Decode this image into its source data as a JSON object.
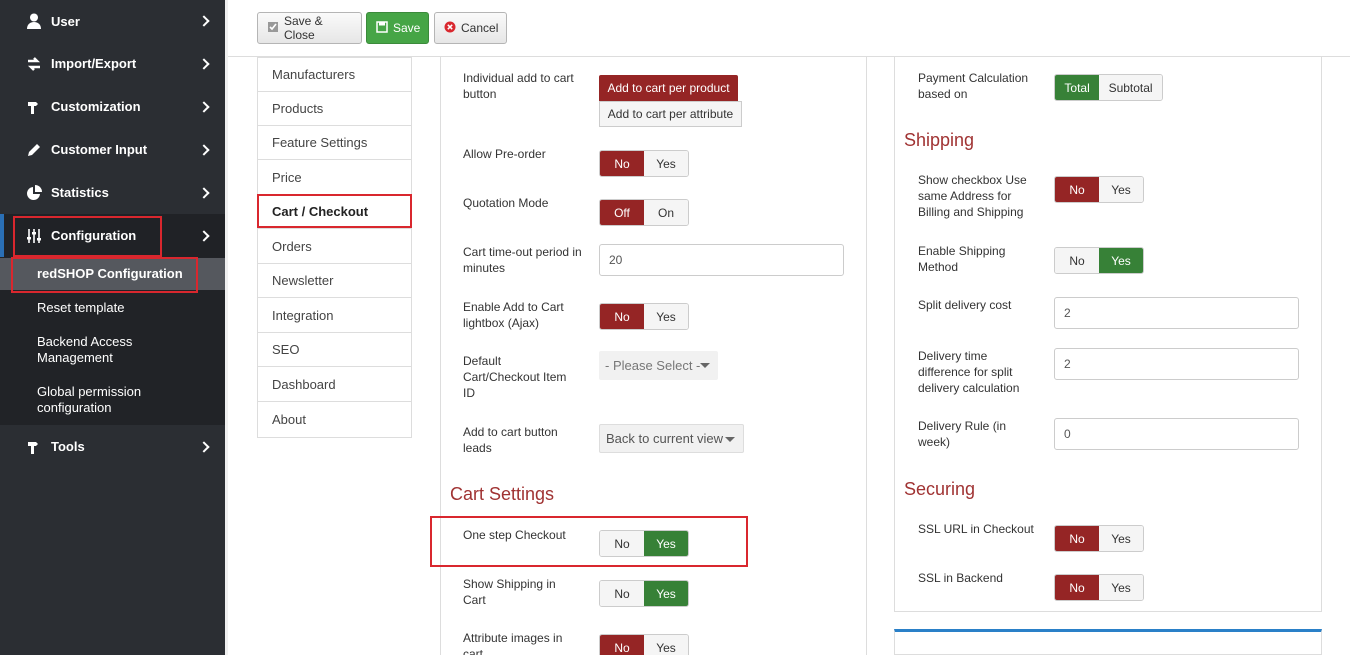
{
  "sidebar": {
    "items": [
      {
        "label": "User",
        "icon": "user-icon"
      },
      {
        "label": "Import/Export",
        "icon": "import-export-icon"
      },
      {
        "label": "Customization",
        "icon": "hammer-icon"
      },
      {
        "label": "Customer Input",
        "icon": "pencil-icon"
      },
      {
        "label": "Statistics",
        "icon": "pie-chart-icon"
      },
      {
        "label": "Configuration",
        "icon": "sliders-icon"
      },
      {
        "label": "Tools",
        "icon": "hammer-icon"
      }
    ],
    "sub_items": [
      "redSHOP Configuration",
      "Reset template",
      "Backend Access Management",
      "Global permission configuration"
    ]
  },
  "toolbar": {
    "save_close": "Save & Close",
    "save": "Save",
    "cancel": "Cancel"
  },
  "tabs": [
    "Manufacturers",
    "Products",
    "Feature Settings",
    "Price",
    "Cart / Checkout",
    "Orders",
    "Newsletter",
    "Integration",
    "SEO",
    "Dashboard",
    "About"
  ],
  "left": {
    "individual_add": {
      "label": "Individual add to cart button",
      "opt1": "Add to cart per product",
      "opt2": "Add to cart per attribute"
    },
    "preorder": {
      "label": "Allow Pre-order",
      "no": "No",
      "yes": "Yes"
    },
    "quotation": {
      "label": "Quotation Mode",
      "off": "Off",
      "on": "On"
    },
    "timeout": {
      "label": "Cart time-out period in minutes",
      "value": "20"
    },
    "lightbox": {
      "label": "Enable Add to Cart lightbox (Ajax)",
      "no": "No",
      "yes": "Yes"
    },
    "default_item": {
      "label": "Default Cart/Checkout Item ID",
      "value": "- Please Select -"
    },
    "button_leads": {
      "label": "Add to cart button leads",
      "value": "Back to current view"
    },
    "cart_settings": "Cart Settings",
    "one_step": {
      "label": "One step Checkout",
      "no": "No",
      "yes": "Yes"
    },
    "show_shipping": {
      "label": "Show Shipping in Cart",
      "no": "No",
      "yes": "Yes"
    },
    "attr_images": {
      "label": "Attribute images in cart",
      "no": "No",
      "yes": "Yes"
    }
  },
  "right": {
    "payment_calc": {
      "label": "Payment Calculation based on",
      "total": "Total",
      "subtotal": "Subtotal"
    },
    "shipping": "Shipping",
    "same_address": {
      "label": "Show checkbox Use same Address for Billing and Shipping",
      "no": "No",
      "yes": "Yes"
    },
    "enable_shipping": {
      "label": "Enable Shipping Method",
      "no": "No",
      "yes": "Yes"
    },
    "split_cost": {
      "label": "Split delivery cost",
      "value": "2"
    },
    "delivery_diff": {
      "label": "Delivery time difference for split delivery calculation",
      "value": "2"
    },
    "delivery_rule": {
      "label": "Delivery Rule (in week)",
      "value": "0"
    },
    "securing": "Securing",
    "ssl_checkout": {
      "label": "SSL URL in Checkout",
      "no": "No",
      "yes": "Yes"
    },
    "ssl_backend": {
      "label": "SSL in Backend",
      "no": "No",
      "yes": "Yes"
    }
  },
  "colors": {
    "sidebar_bg": "#2b2e33",
    "red": "#952525",
    "green": "#378137",
    "highlight": "#d9272e"
  }
}
